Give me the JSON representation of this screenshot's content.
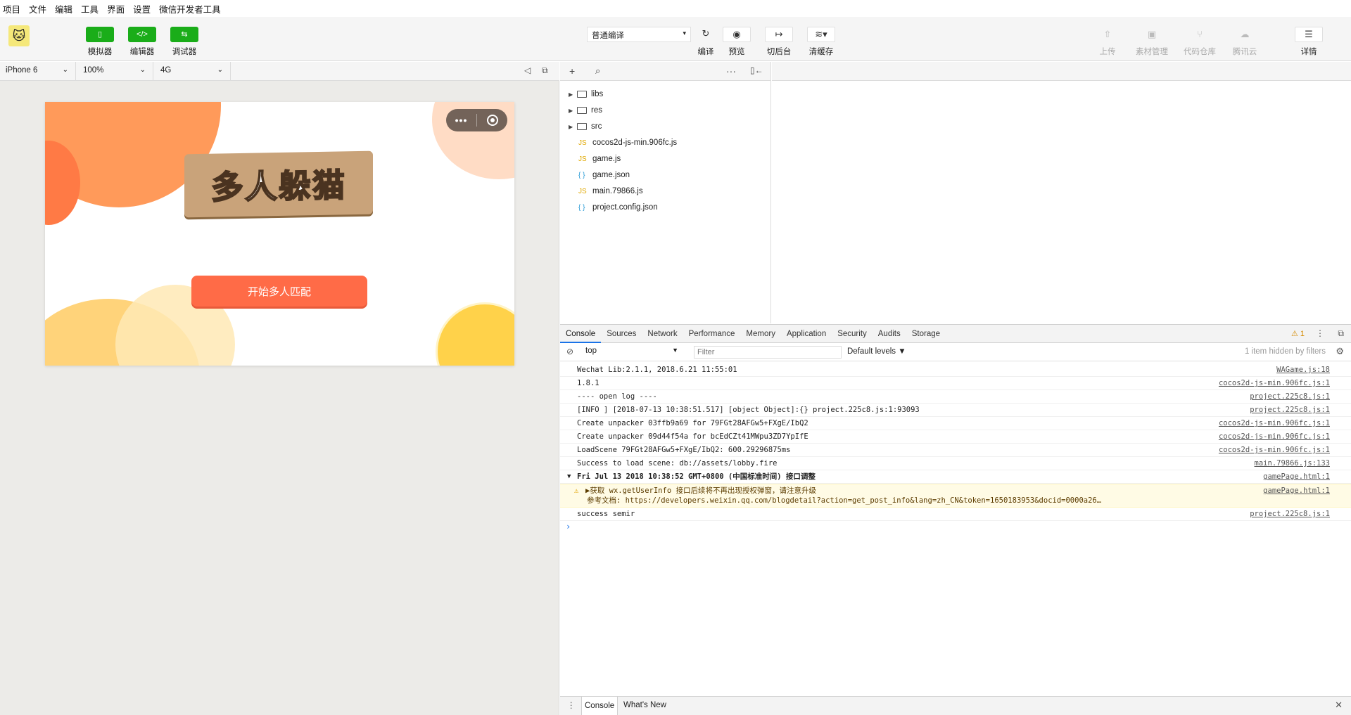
{
  "menu": [
    "项目",
    "文件",
    "编辑",
    "工具",
    "界面",
    "设置",
    "微信开发者工具"
  ],
  "toolbar": {
    "simulator": "模拟器",
    "editor": "编辑器",
    "debugger": "调试器",
    "compile_mode": "普通编译",
    "compile": "编译",
    "preview": "预览",
    "background": "切后台",
    "clear_cache": "清缓存",
    "upload": "上传",
    "assets": "素材管理",
    "repo": "代码仓库",
    "tencent_cloud": "腾讯云",
    "details": "详情"
  },
  "simbar": {
    "device": "iPhone 6",
    "zoom": "100%",
    "network": "4G"
  },
  "game": {
    "title": "多人躲猫",
    "start_button": "开始多人匹配"
  },
  "files": [
    {
      "name": "libs",
      "type": "folder"
    },
    {
      "name": "res",
      "type": "folder"
    },
    {
      "name": "src",
      "type": "folder"
    },
    {
      "name": "cocos2d-js-min.906fc.js",
      "type": "JS"
    },
    {
      "name": "game.js",
      "type": "JS"
    },
    {
      "name": "game.json",
      "type": "{ }"
    },
    {
      "name": "main.79866.js",
      "type": "JS"
    },
    {
      "name": "project.config.json",
      "type": "{ }"
    }
  ],
  "devtools": {
    "tabs": [
      "Console",
      "Sources",
      "Network",
      "Performance",
      "Memory",
      "Application",
      "Security",
      "Audits",
      "Storage"
    ],
    "warning_count": "1",
    "context": "top",
    "filter_placeholder": "Filter",
    "levels": "Default levels",
    "hidden": "1 item hidden by filters"
  },
  "console": [
    {
      "text": "Wechat Lib:2.1.1, 2018.6.21 11:55:01",
      "src": "WAGame.js:18"
    },
    {
      "text": "1.8.1",
      "src": "cocos2d-js-min.906fc.js:1"
    },
    {
      "text": "---- open log ----",
      "src": "project.225c8.js:1"
    },
    {
      "text": "[INFO ] [2018-07-13 10:38:51.517] [object Object]:{} project.225c8.js:1:93093",
      "src": "project.225c8.js:1"
    },
    {
      "text": "Create unpacker 03ffb9a69 for 79FGt28AFGw5+FXgE/IbQ2",
      "src": "cocos2d-js-min.906fc.js:1"
    },
    {
      "text": "Create unpacker 09d44f54a for bcEdCZt41MWpu3ZD7YpIfE",
      "src": "cocos2d-js-min.906fc.js:1"
    },
    {
      "text": "LoadScene 79FGt28AFGw5+FXgE/IbQ2: 600.29296875ms",
      "src": "cocos2d-js-min.906fc.js:1"
    },
    {
      "text": "Success to load scene: db://assets/lobby.fire",
      "src": "main.79866.js:133"
    },
    {
      "text": "Fri Jul 13 2018 10:38:52 GMT+0800 (中国标准时间) 接口调整",
      "src": "gamePage.html:1"
    },
    {
      "text": "▶获取 wx.getUserInfo 接口后续将不再出现授权弹窗，请注意升级",
      "src": "gamePage.html:1"
    },
    {
      "text": "参考文档: https://developers.weixin.qq.com/blogdetail?action=get_post_info&lang=zh_CN&token=1650183953&docid=0000a26…",
      "src": ""
    },
    {
      "text": "success semir",
      "src": "project.225c8.js:1"
    }
  ],
  "bottom_tabs": [
    "Console",
    "What's New"
  ]
}
